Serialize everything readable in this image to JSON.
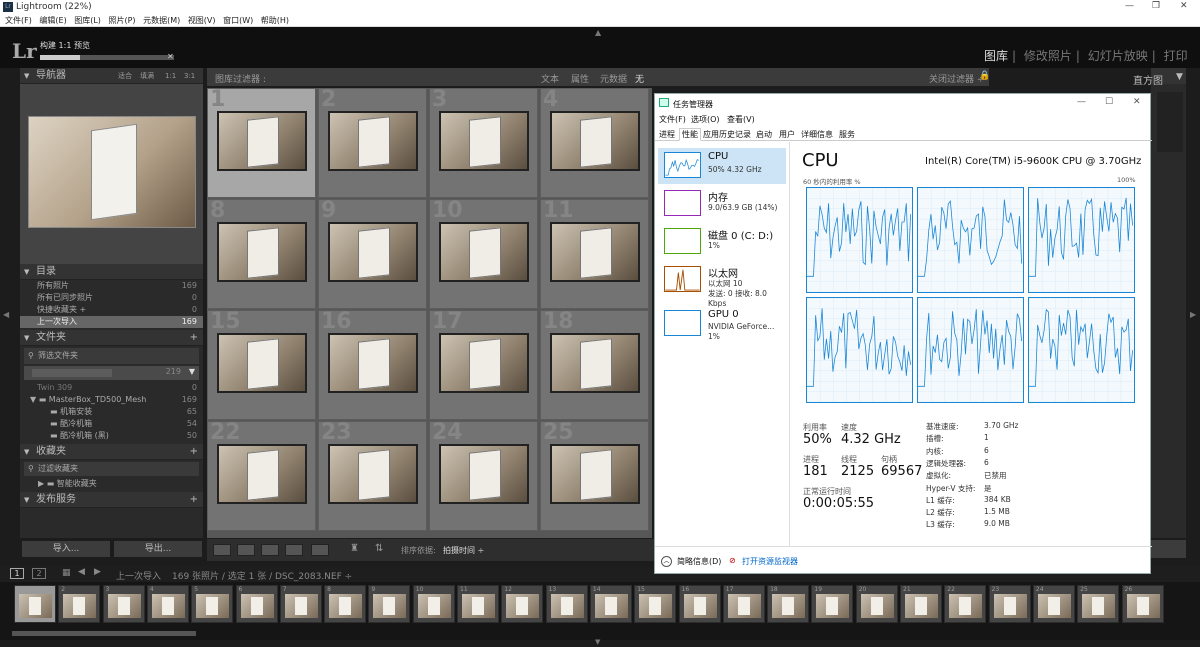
{
  "window": {
    "title": "Lightroom (22%)",
    "controls": [
      "—",
      "❐",
      "✕"
    ]
  },
  "menu": [
    "文件(F)",
    "编辑(E)",
    "图库(L)",
    "照片(P)",
    "元数据(M)",
    "视图(V)",
    "窗口(W)",
    "帮助(H)"
  ],
  "identity": {
    "logo": "Lr",
    "task": "构建 1:1 预览",
    "progress": 0.3
  },
  "modules": [
    "图库",
    "修改照片",
    "幻灯片放映",
    "打印"
  ],
  "navigator": {
    "title": "导航器",
    "zooms": [
      "适合",
      "填满",
      "1:1",
      "3:1"
    ]
  },
  "catalog": {
    "title": "目录",
    "items": [
      {
        "label": "所有照片",
        "count": "169"
      },
      {
        "label": "所有已同步照片",
        "count": "0"
      },
      {
        "label": "快捷收藏夹 +",
        "count": "0"
      },
      {
        "label": "上一次导入",
        "count": "169"
      }
    ]
  },
  "folders": {
    "title": "文件夹",
    "filter": "筛选文件夹",
    "volume_count": "219",
    "items": [
      {
        "label": "Twin 309",
        "count": "0"
      },
      {
        "label": "MasterBox_TD500_Mesh",
        "count": "169"
      },
      {
        "label": "机箱安装",
        "count": "65"
      },
      {
        "label": "酷冷机箱",
        "count": "54"
      },
      {
        "label": "酷冷机箱 (黑)",
        "count": "50"
      }
    ]
  },
  "collections": {
    "title": "收藏夹",
    "filter": "过滤收藏夹",
    "item": "智能收藏夹"
  },
  "publish": {
    "title": "发布服务"
  },
  "buttons": {
    "import": "导入...",
    "export": "导出..."
  },
  "filterbar": {
    "title": "图库过滤器 :",
    "options": [
      "文本",
      "属性",
      "元数据",
      "无"
    ],
    "close": "关闭过滤器 ÷"
  },
  "grid_numbers": [
    "1",
    "2",
    "3",
    "4",
    "8",
    "9",
    "10",
    "11",
    "15",
    "16",
    "17",
    "18",
    "22",
    "23",
    "24",
    "25"
  ],
  "toolbar": {
    "sort_label": "排序依据:",
    "sort_value": "拍摄时间 ÷"
  },
  "right": {
    "histogram": "直方图"
  },
  "filmbar": {
    "source": "上一次导入",
    "count": "169 张照片 / 选定 1 张 / DSC_2083.NEF ÷",
    "screens": [
      "1",
      "2"
    ]
  },
  "filmstrip_numbers": [
    "1",
    "2",
    "3",
    "4",
    "5",
    "6",
    "7",
    "8",
    "9",
    "10",
    "11",
    "12",
    "13",
    "14",
    "15",
    "16",
    "17",
    "18",
    "19",
    "20",
    "21",
    "22",
    "23",
    "24",
    "25",
    "26"
  ],
  "taskmanager": {
    "title": "任务管理器",
    "menu": [
      "文件(F)",
      "选项(O)",
      "查看(V)"
    ],
    "tabs": [
      "进程",
      "性能",
      "应用历史记录",
      "启动",
      "用户",
      "详细信息",
      "服务"
    ],
    "resources": [
      {
        "name": "CPU",
        "sub": "50%  4.32 GHz"
      },
      {
        "name": "内存",
        "sub": "9.0/63.9 GB (14%)"
      },
      {
        "name": "磁盘 0 (C: D:)",
        "sub": "1%"
      },
      {
        "name": "以太网",
        "sub": "以太网 10",
        "sub2": "发送: 0 接收: 8.0 Kbps"
      },
      {
        "name": "GPU 0",
        "sub": "NVIDIA GeForce...",
        "sub2": "1%"
      }
    ],
    "cpu_title": "CPU",
    "cpu_model": "Intel(R) Core(TM) i5-9600K CPU @ 3.70GHz",
    "graph_label": "60 秒内的利用率 %",
    "graph_max": "100%",
    "stats": {
      "util_label": "利用率",
      "util": "50%",
      "speed_label": "速度",
      "speed": "4.32 GHz",
      "proc_label": "进程",
      "proc": "181",
      "thread_label": "线程",
      "thread": "2125",
      "handle_label": "句柄",
      "handle": "69567",
      "uptime_label": "正常运行时间",
      "uptime": "0:00:05:55"
    },
    "specs": [
      {
        "k": "基准速度:",
        "v": "3.70 GHz"
      },
      {
        "k": "插槽:",
        "v": "1"
      },
      {
        "k": "内核:",
        "v": "6"
      },
      {
        "k": "逻辑处理器:",
        "v": "6"
      },
      {
        "k": "虚拟化:",
        "v": "已禁用"
      },
      {
        "k": "Hyper-V 支持:",
        "v": "是"
      },
      {
        "k": "L1 缓存:",
        "v": "384 KB"
      },
      {
        "k": "L2 缓存:",
        "v": "1.5 MB"
      },
      {
        "k": "L3 缓存:",
        "v": "9.0 MB"
      }
    ],
    "footer": {
      "brief": "简略信息(D)",
      "monitor": "打开资源监视器"
    }
  }
}
